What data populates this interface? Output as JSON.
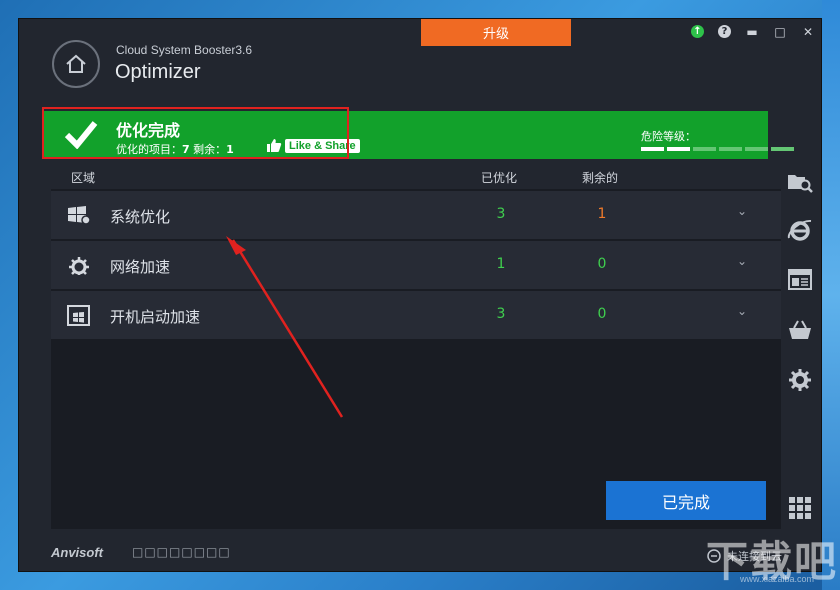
{
  "window": {
    "app_name": "Cloud System Booster3.6",
    "title": "Optimizer",
    "upgrade_label": "升级"
  },
  "status": {
    "title": "优化完成",
    "items_label": "优化的项目：",
    "items_count": "7",
    "remaining_label": "剩余：",
    "remaining_count": "1",
    "like_label": "Like & Share",
    "danger_label": "危险等级：",
    "danger_level_segments_filled": 2,
    "danger_level_segments_total": 6
  },
  "table": {
    "headers": {
      "area": "区域",
      "optimized": "已优化",
      "remaining": "剩余的"
    },
    "rows": [
      {
        "icon": "windows-settings-icon",
        "label": "系统优化",
        "optimized": "3",
        "remaining": "1",
        "remaining_color": "#f07a2a"
      },
      {
        "icon": "network-gear-icon",
        "label": "网络加速",
        "optimized": "1",
        "remaining": "0",
        "remaining_color": "#3fd04e"
      },
      {
        "icon": "startup-window-icon",
        "label": "开机启动加速",
        "optimized": "3",
        "remaining": "0",
        "remaining_color": "#3fd04e"
      }
    ]
  },
  "actions": {
    "done_label": "已完成"
  },
  "footer": {
    "brand": "Anvisoft",
    "brand_sub": "□□□□□□□□",
    "cloud_status": "未连接到云"
  },
  "watermark": {
    "text": "下载吧",
    "sub": "www.xiazaiba.com"
  },
  "colors": {
    "accent_green": "#12a12b",
    "upgrade_orange": "#f06a23",
    "done_blue": "#1b73d3",
    "annotation_red": "#e0221f"
  }
}
